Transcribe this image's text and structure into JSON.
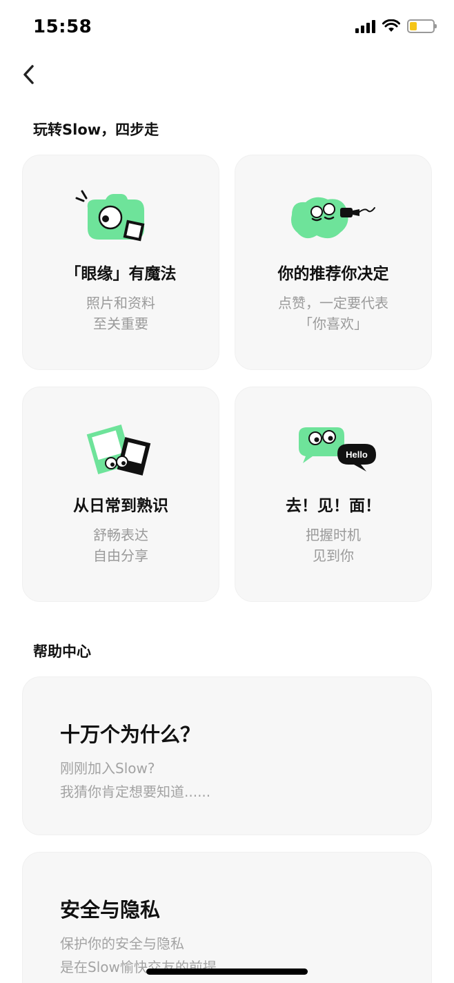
{
  "status_bar": {
    "time": "15:58"
  },
  "guide": {
    "heading": "玩转Slow，四步走",
    "cards": [
      {
        "title": "「眼缘」有魔法",
        "line1": "照片和资料",
        "line2": "至关重要",
        "icon": "camera-icon"
      },
      {
        "title": "你的推荐你决定",
        "line1": "点赞，一定要代表",
        "line2": "「你喜欢」",
        "icon": "microphone-icon"
      },
      {
        "title": "从日常到熟识",
        "line1": "舒畅表达",
        "line2": "自由分享",
        "icon": "photos-icon"
      },
      {
        "title": "去！见！面！",
        "line1": "把握时机",
        "line2": "见到你",
        "icon": "chat-bubble-icon",
        "bubble_text": "Hello"
      }
    ]
  },
  "help": {
    "heading": "帮助中心",
    "cards": [
      {
        "title": "十万个为什么？",
        "line1": "刚刚加入Slow?",
        "line2": "我猜你肯定想要知道......"
      },
      {
        "title": "安全与隐私",
        "line1": "保护你的安全与隐私",
        "line2": "是在Slow愉快交友的前提"
      }
    ]
  },
  "colors": {
    "accent": "#6ee39a",
    "card_bg": "#f7f7f7",
    "subtext": "#9a9a9a"
  }
}
